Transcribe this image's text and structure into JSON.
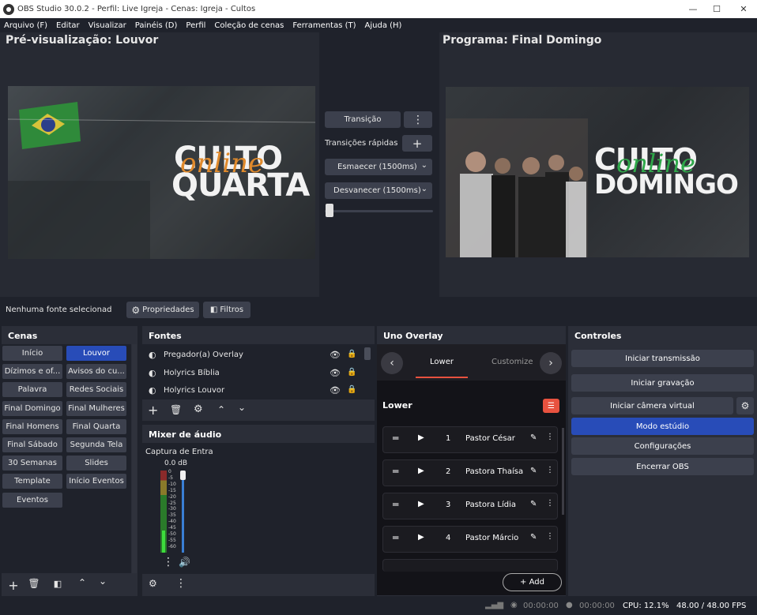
{
  "window": {
    "title": "OBS Studio 30.0.2 - Perfil: Live Igreja - Cenas: Igreja - Cultos",
    "min": "—",
    "max": "☐",
    "close": "✕"
  },
  "menu": [
    "Arquivo (F)",
    "Editar",
    "Visualizar",
    "Painéis (D)",
    "Perfil",
    "Coleção de cenas",
    "Ferramentas (T)",
    "Ajuda (H)"
  ],
  "preview": {
    "title": "Pré-visualização: Louvor",
    "line1": "CULTO",
    "script": "online",
    "line2": "QUARTA"
  },
  "program": {
    "title": "Programa: Final Domingo",
    "line1": "CULTO",
    "script": "online",
    "line2": "DOMINGO"
  },
  "transition": {
    "button": "Transição",
    "quick": "Transições rápidas",
    "opt1": "Esmaecer (1500ms)",
    "opt2": "Desvanecer (1500ms)",
    "slider": 0
  },
  "sourcebar": {
    "status": "Nenhuma fonte selecionad",
    "properties": "Propriedades",
    "filters": "Filtros"
  },
  "scenes": {
    "title": "Cenas",
    "items": [
      "Início",
      "Louvor",
      "Dízimos e of...",
      "Avisos do cu...",
      "Palavra",
      "Redes Sociais",
      "Final Domingo",
      "Final Mulheres",
      "Final Homens",
      "Final Quarta",
      "Final Sábado",
      "Segunda Tela",
      "30 Semanas",
      "Slides",
      "Template",
      "Início Eventos",
      "Eventos"
    ],
    "selected": "Louvor"
  },
  "sources": {
    "title": "Fontes",
    "items": [
      "Pregador(a) Overlay",
      "Holyrics Bíblia",
      "Holyrics Louvor"
    ]
  },
  "mixer": {
    "title": "Mixer de áudio",
    "channel": "Captura de Entra",
    "level": "0.0 dB",
    "scale": [
      "0",
      "-5",
      "-10",
      "-15",
      "-20",
      "-25",
      "-30",
      "-35",
      "-40",
      "-45",
      "-50",
      "-55",
      "-60"
    ]
  },
  "uno": {
    "title": "Uno Overlay",
    "tab1": "Lower",
    "tab2": "Customize",
    "section": "Lower",
    "add": "+ Add",
    "items": [
      {
        "n": "1",
        "name": "Pastor César"
      },
      {
        "n": "2",
        "name": "Pastora Thaísa"
      },
      {
        "n": "3",
        "name": "Pastora Lídia"
      },
      {
        "n": "4",
        "name": "Pastor Márcio"
      }
    ]
  },
  "controls": {
    "title": "Controles",
    "stream": "Iniciar transmissão",
    "record": "Iniciar gravação",
    "vcam": "Iniciar câmera virtual",
    "studio": "Modo estúdio",
    "settings": "Configurações",
    "exit": "Encerrar OBS"
  },
  "status": {
    "stream_time": "00:00:00",
    "rec_time": "00:00:00",
    "cpu": "CPU: 12.1%",
    "fps": "48.00 / 48.00 FPS"
  },
  "colors": {
    "accent": "#284cb8",
    "uno_accent": "#e8523f",
    "orange": "#e08a2c",
    "green": "#2fa84a"
  }
}
